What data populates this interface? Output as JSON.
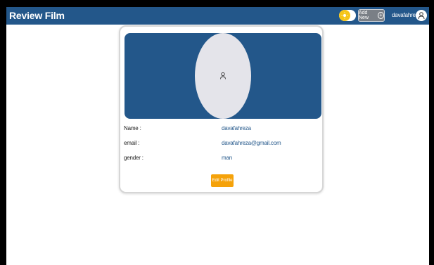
{
  "navbar": {
    "brand": "Review Film",
    "add_new_label": "Add New",
    "username": "davafahreza"
  },
  "profile": {
    "rows": [
      {
        "label": "Name :",
        "value": "davafahreza"
      },
      {
        "label": "email :",
        "value": "davafahreza@gmail.com"
      },
      {
        "label": "gender :",
        "value": "man"
      }
    ],
    "edit_label": "Edit Profile"
  },
  "colors": {
    "primary": "#23578a",
    "accent": "#f5a20a",
    "toggle_knob": "#f5c518"
  },
  "icons": {
    "theme_toggle": "sun-icon",
    "add_new": "plus-circle-icon",
    "user_avatar": "user-icon"
  }
}
